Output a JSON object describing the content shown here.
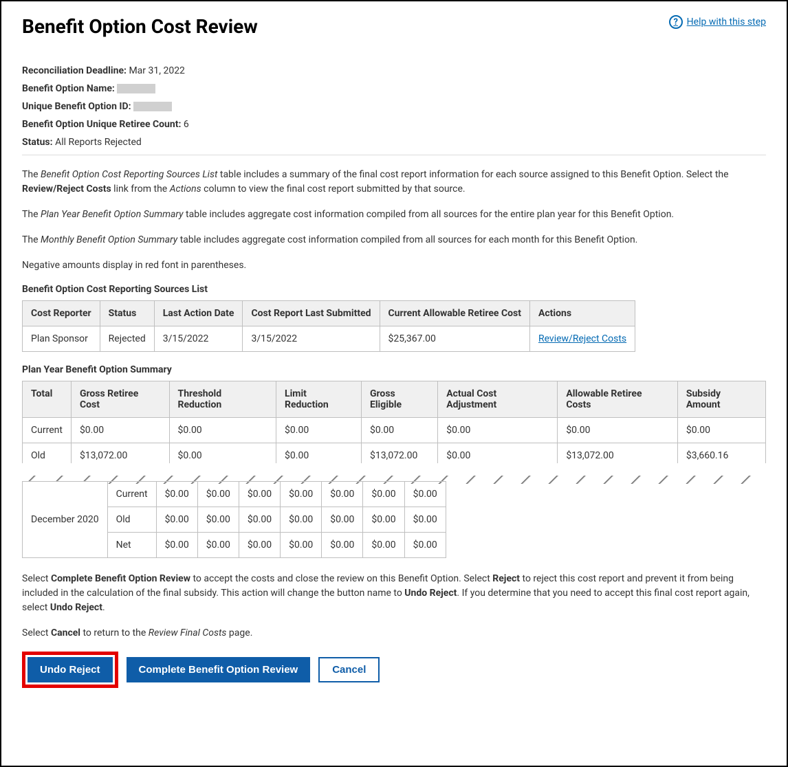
{
  "header": {
    "title": "Benefit Option Cost Review",
    "help": "Help with this step"
  },
  "meta": {
    "recon_deadline_label": "Reconciliation Deadline:",
    "recon_deadline": "Mar 31, 2022",
    "opt_name_label": "Benefit Option Name:",
    "opt_id_label": "Unique Benefit Option ID:",
    "retiree_count_label": "Benefit Option Unique Retiree Count:",
    "retiree_count": "6",
    "status_label": "Status:",
    "status": "All Reports Rejected"
  },
  "intro": {
    "p1a": "The ",
    "p1b": "Benefit Option Cost Reporting Sources List",
    "p1c": " table includes a summary of the final cost report information for each source assigned to this Benefit Option. Select the ",
    "p1d": "Review/Reject Costs",
    "p1e": " link from the ",
    "p1f": "Actions",
    "p1g": " column to view the final cost report submitted by that source.",
    "p2a": "The ",
    "p2b": "Plan Year Benefit Option Summary",
    "p2c": " table includes aggregate cost information compiled from all sources for the entire plan year for this Benefit Option.",
    "p3a": "The ",
    "p3b": "Monthly Benefit Option Summary",
    "p3c": " table includes aggregate cost information compiled from all sources for each month for this Benefit Option.",
    "p4": "Negative amounts display in red font in parentheses."
  },
  "sources": {
    "title": "Benefit Option Cost Reporting Sources List",
    "headers": {
      "h1": "Cost Reporter",
      "h2": "Status",
      "h3": "Last Action Date",
      "h4": "Cost Report Last Submitted",
      "h5": "Current Allowable Retiree Cost",
      "h6": "Actions"
    },
    "row": {
      "reporter": "Plan Sponsor",
      "status": "Rejected",
      "last_action": "3/15/2022",
      "last_submitted": "3/15/2022",
      "allow_cost": "$25,367.00",
      "action_link": "Review/Reject Costs"
    }
  },
  "plan_year": {
    "title": "Plan Year Benefit Option Summary",
    "headers": {
      "h1": "Total",
      "h2": "Gross Retiree Cost",
      "h3": "Threshold Reduction",
      "h4": "Limit Reduction",
      "h5": "Gross Eligible",
      "h6": "Actual Cost Adjustment",
      "h7": "Allowable Retiree Costs",
      "h8": "Subsidy Amount"
    },
    "row_current": {
      "label": "Current",
      "c1": "$0.00",
      "c2": "$0.00",
      "c3": "$0.00",
      "c4": "$0.00",
      "c5": "$0.00",
      "c6": "$0.00",
      "c7": "$0.00"
    },
    "row_old": {
      "label": "Old",
      "c1": "$13,072.00",
      "c2": "$0.00",
      "c3": "$0.00",
      "c4": "$13,072.00",
      "c5": "$0.00",
      "c6": "$13,072.00",
      "c7": "$3,660.16"
    }
  },
  "monthly": {
    "month_label": "December 2020",
    "row_current": {
      "label": "Current",
      "c1": "$0.00",
      "c2": "$0.00",
      "c3": "$0.00",
      "c4": "$0.00",
      "c5": "$0.00",
      "c6": "$0.00",
      "c7": "$0.00"
    },
    "row_old": {
      "label": "Old",
      "c1": "$0.00",
      "c2": "$0.00",
      "c3": "$0.00",
      "c4": "$0.00",
      "c5": "$0.00",
      "c6": "$0.00",
      "c7": "$0.00"
    },
    "row_net": {
      "label": "Net",
      "c1": "$0.00",
      "c2": "$0.00",
      "c3": "$0.00",
      "c4": "$0.00",
      "c5": "$0.00",
      "c6": "$0.00",
      "c7": "$0.00"
    }
  },
  "footer": {
    "p1a": "Select ",
    "p1b": "Complete Benefit Option Review",
    "p1c": " to accept the costs and close the review on this Benefit Option. Select ",
    "p1d": "Reject",
    "p1e": " to reject this cost report and prevent it from being included in the calculation of the final subsidy. This action will change the button name to ",
    "p1f": "Undo Reject",
    "p1g": ". If you determine that you need to accept this final cost report again, select ",
    "p1h": "Undo Reject",
    "p1i": ".",
    "p2a": "Select ",
    "p2b": "Cancel",
    "p2c": " to return to the ",
    "p2d": "Review Final Costs",
    "p2e": " page."
  },
  "buttons": {
    "undo": "Undo Reject",
    "complete": "Complete Benefit Option Review",
    "cancel": "Cancel"
  }
}
